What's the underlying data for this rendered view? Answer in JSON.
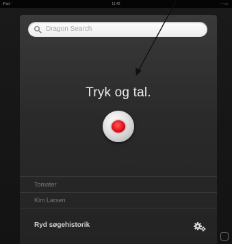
{
  "status_bar": {
    "left": "iPad ◦",
    "time": "11:42",
    "right": "◦ ◦ ▭"
  },
  "search": {
    "placeholder": "Dragon Search",
    "icon": "search-icon"
  },
  "prompt": "Tryk og tal.",
  "mic": {
    "icon": "record-icon",
    "accent": "#e0141c"
  },
  "history": {
    "items": [
      "Tomater",
      "Kim Larsen"
    ]
  },
  "clear": {
    "label": "Ryd søgehistorik",
    "icon": "gear-icon"
  }
}
